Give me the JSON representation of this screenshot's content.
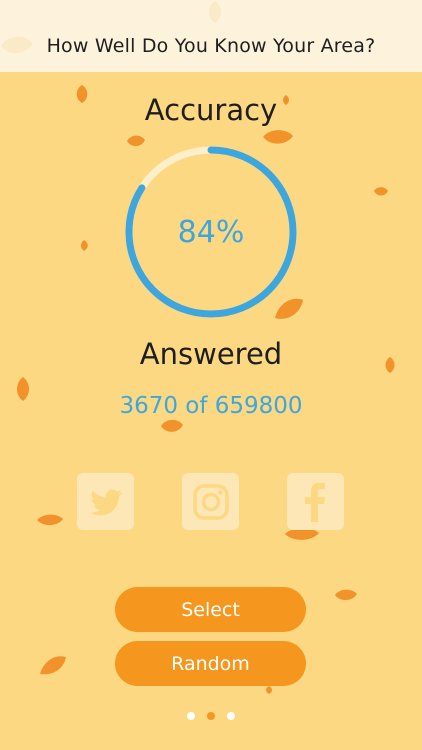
{
  "header": {
    "title": "How Well Do You Know Your Area?"
  },
  "accuracy": {
    "title": "Accuracy",
    "percent_label": "84%",
    "fraction": 0.84,
    "ring_color": "#3ea6dc",
    "track_color": "#fdefc9"
  },
  "answered": {
    "title": "Answered",
    "count_label": "3670 of 659800"
  },
  "social": {
    "items": [
      {
        "icon": "twitter-icon"
      },
      {
        "icon": "instagram-icon"
      },
      {
        "icon": "facebook-icon"
      }
    ]
  },
  "buttons": {
    "select_label": "Select",
    "random_label": "Random"
  },
  "pager": {
    "count": 3,
    "active_index": 1
  },
  "colors": {
    "background": "#fdd882",
    "header": "#fdf3dc",
    "accent": "#f5961e",
    "leaf": "#f2922a"
  }
}
